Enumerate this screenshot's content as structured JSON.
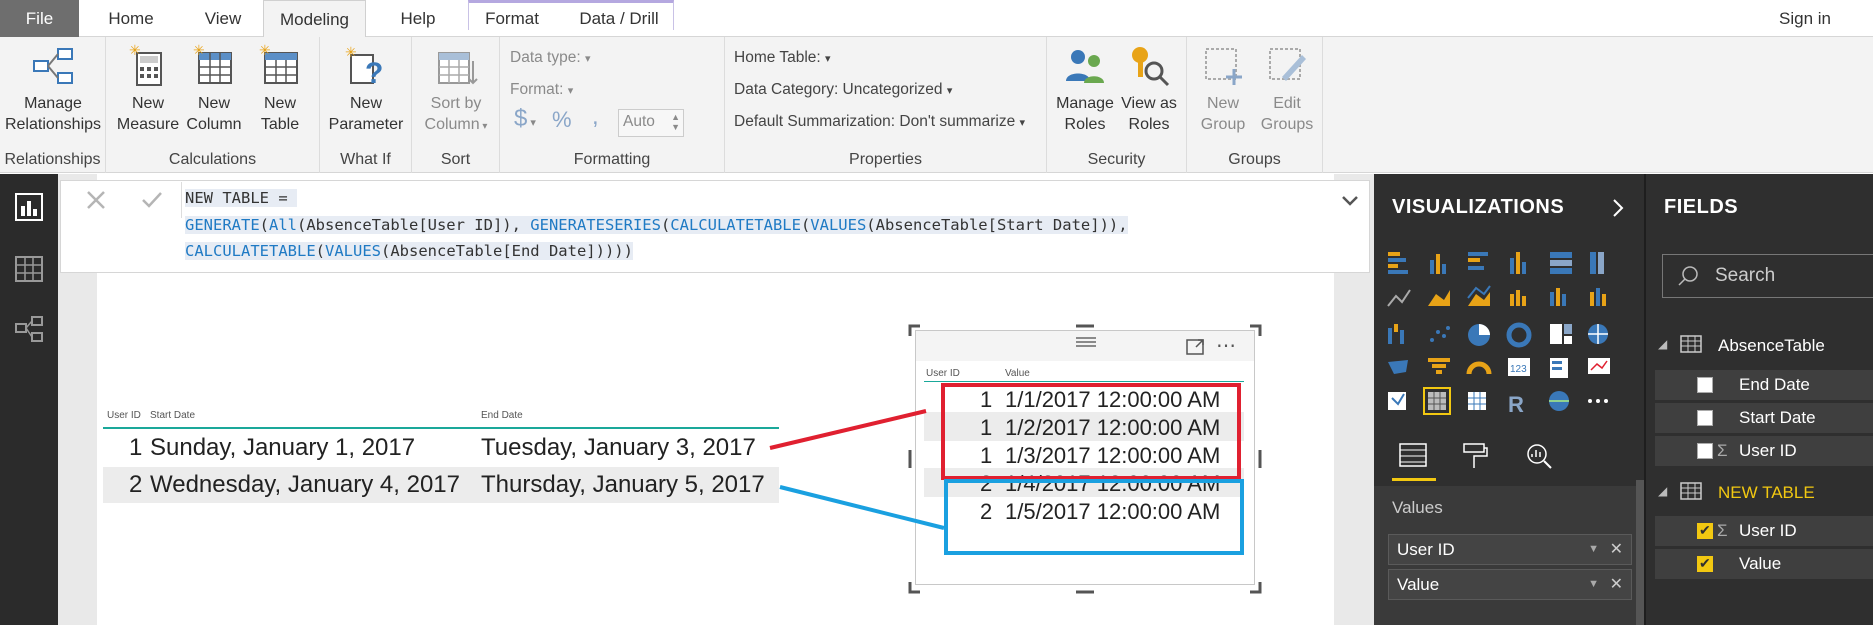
{
  "tabs": {
    "file": "File",
    "home": "Home",
    "view": "View",
    "modeling": "Modeling",
    "help": "Help",
    "format": "Format",
    "data_drill": "Data / Drill",
    "sign_in": "Sign in"
  },
  "ribbon": {
    "relationships": {
      "button": [
        "Manage",
        "Relationships"
      ],
      "label": "Relationships"
    },
    "calculations": {
      "new_measure": [
        "New",
        "Measure"
      ],
      "new_column": [
        "New",
        "Column"
      ],
      "new_table": [
        "New",
        "Table"
      ],
      "label": "Calculations"
    },
    "whatif": {
      "new_parameter": [
        "New",
        "Parameter"
      ],
      "label": "What If"
    },
    "sort": {
      "sort_by_column": [
        "Sort by",
        "Column"
      ],
      "label": "Sort"
    },
    "formatting": {
      "data_type": "Data type:",
      "format": "Format:",
      "currency": "$",
      "percent": "%",
      "comma": ",",
      "auto": "Auto",
      "label": "Formatting"
    },
    "properties": {
      "home_table": "Home Table:",
      "data_category": "Data Category: Uncategorized",
      "default_summarization": "Default Summarization: Don't summarize",
      "label": "Properties"
    },
    "security": {
      "manage_roles": [
        "Manage",
        "Roles"
      ],
      "view_as_roles": [
        "View as",
        "Roles"
      ],
      "label": "Security"
    },
    "groups": {
      "new_group": [
        "New",
        "Group"
      ],
      "edit_groups": [
        "Edit",
        "Groups"
      ],
      "label": "Groups"
    }
  },
  "formula": {
    "line1": "NEW TABLE = ",
    "line2_parts": [
      "GENERATE",
      "(",
      "All",
      "(AbsenceTable[User ID]), ",
      "GENERATESERIES",
      "(",
      "CALCULATETABLE",
      "(",
      "VALUES",
      "(AbsenceTable[Start Date])),"
    ],
    "line3_parts": [
      "CALCULATETABLE",
      "(",
      "VALUES",
      "(AbsenceTable[End Date]))))"
    ]
  },
  "left_table": {
    "headers": [
      "User ID",
      "Start Date",
      "End Date"
    ],
    "rows": [
      [
        "1",
        "Sunday, January 1, 2017",
        "Tuesday, January 3, 2017"
      ],
      [
        "2",
        "Wednesday, January 4, 2017",
        "Thursday, January 5, 2017"
      ]
    ]
  },
  "right_table": {
    "headers": [
      "User ID",
      "Value"
    ],
    "rows": [
      [
        "1",
        "1/1/2017 12:00:00 AM"
      ],
      [
        "1",
        "1/2/2017 12:00:00 AM"
      ],
      [
        "1",
        "1/3/2017 12:00:00 AM"
      ],
      [
        "2",
        "1/4/2017 12:00:00 AM"
      ],
      [
        "2",
        "1/5/2017 12:00:00 AM"
      ]
    ]
  },
  "annotation_colors": {
    "red": "#e02030",
    "blue": "#1aa0e0"
  },
  "visualizations": {
    "title": "VISUALIZATIONS",
    "values_label": "Values",
    "wells": [
      "User ID",
      "Value"
    ]
  },
  "fields": {
    "title": "FIELDS",
    "search_placeholder": "Search",
    "tables": [
      {
        "name": "AbsenceTable",
        "fields": [
          {
            "name": "End Date",
            "sigma": false,
            "checked": false
          },
          {
            "name": "Start Date",
            "sigma": false,
            "checked": false
          },
          {
            "name": "User ID",
            "sigma": true,
            "checked": false
          }
        ]
      },
      {
        "name": "NEW TABLE",
        "fields": [
          {
            "name": "User ID",
            "sigma": true,
            "checked": true
          },
          {
            "name": "Value",
            "sigma": false,
            "checked": true
          }
        ]
      }
    ]
  },
  "accent_color": "#f2c811"
}
